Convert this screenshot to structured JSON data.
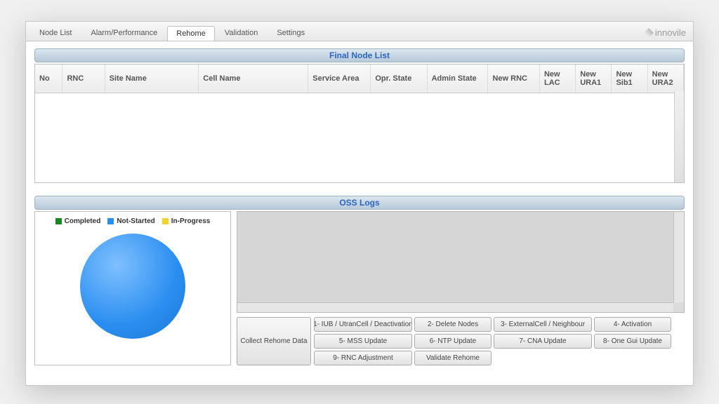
{
  "brand": "innovile",
  "tabs": [
    {
      "label": "Node List"
    },
    {
      "label": "Alarm/Performance"
    },
    {
      "label": "Rehome",
      "active": true
    },
    {
      "label": "Validation"
    },
    {
      "label": "Settings"
    }
  ],
  "panels": {
    "final_node_list": "Final Node List",
    "oss_logs": "OSS Logs"
  },
  "columns": [
    "No",
    "RNC",
    "Site Name",
    "Cell Name",
    "Service Area",
    "Opr. State",
    "Admin State",
    "New RNC",
    "New LAC",
    "New URA1",
    "New Sib1",
    "New URA2"
  ],
  "col_widths": [
    "35px",
    "54px",
    "120px",
    "140px",
    "80px",
    "72px",
    "78px",
    "66px",
    "46px",
    "46px",
    "46px",
    "46px"
  ],
  "legend": [
    {
      "label": "Completed",
      "color": "#178a1e"
    },
    {
      "label": "Not-Started",
      "color": "#2a8ef0"
    },
    {
      "label": "In-Progress",
      "color": "#f2d32b"
    }
  ],
  "collect_label": "Collect Rehome Data",
  "actions": [
    "1- IUB / UtranCell / Deactivation",
    "2- Delete Nodes",
    "3- ExternalCell / Neighbour",
    "4- Activation",
    "5- MSS Update",
    "6- NTP Update",
    "7- CNA Update",
    "8- One Gui Update",
    "9- RNC Adjustment",
    "Validate Rehome"
  ],
  "chart_data": {
    "type": "pie",
    "title": "",
    "series": [
      {
        "name": "Completed",
        "value": 0,
        "color": "#178a1e"
      },
      {
        "name": "Not-Started",
        "value": 100,
        "color": "#2a8ef0"
      },
      {
        "name": "In-Progress",
        "value": 0,
        "color": "#f2d32b"
      }
    ]
  }
}
